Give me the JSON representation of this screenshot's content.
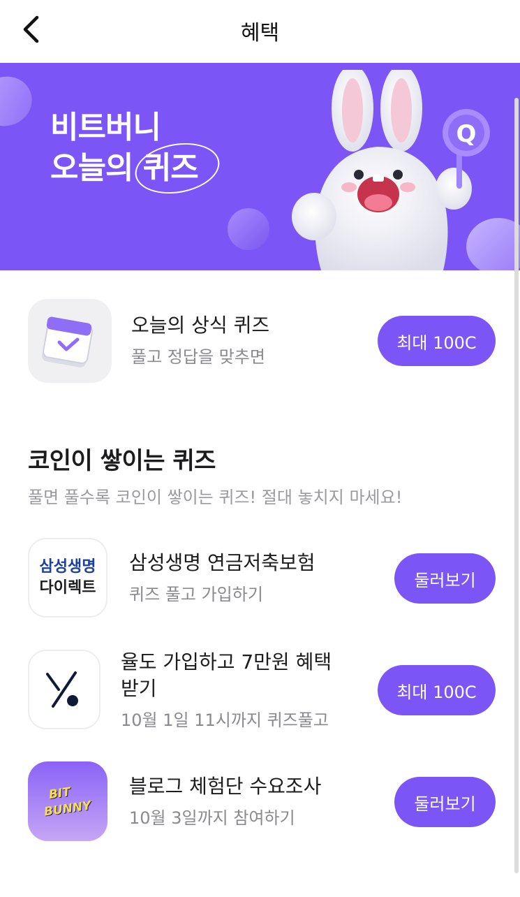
{
  "header": {
    "title": "혜택",
    "back_icon": "chevron-left-icon"
  },
  "banner": {
    "line1": "비트버니",
    "line2_prefix": "오늘의 ",
    "line2_highlight": "퀴즈",
    "mascot_badge": "Q",
    "bg_color": "#7c55f6"
  },
  "daily_quiz": {
    "title": "오늘의 상식 퀴즈",
    "subtitle": "풀고 정답을 맞추면",
    "button": "최대 100C",
    "icon": "calendar-check-icon"
  },
  "section": {
    "title": "코인이 쌓이는 퀴즈",
    "subtitle": "풀면 풀수록 코인이 쌓이는 퀴즈! 절대 놓치지 마세요!"
  },
  "items": [
    {
      "logo_line1": "삼성생명",
      "logo_line2": "다이렉트",
      "title": "삼성생명 연금저축보험",
      "subtitle": "퀴즈 풀고 가입하기",
      "button": "둘러보기"
    },
    {
      "logo": "yuldo-logo",
      "title_line1": "율도 가입하고 7만원 혜택",
      "title_line2": "받기",
      "subtitle": "10월 1일 11시까지 퀴즈풀고",
      "button": "최대 100C"
    },
    {
      "logo_line1": "BIT",
      "logo_line2": "BUNNY",
      "title": "블로그 체험단 수요조사",
      "subtitle": "10월 3일까지 참여하기",
      "button": "둘러보기"
    }
  ],
  "colors": {
    "accent": "#7c55f6",
    "samsung_blue": "#1b3f9e"
  }
}
